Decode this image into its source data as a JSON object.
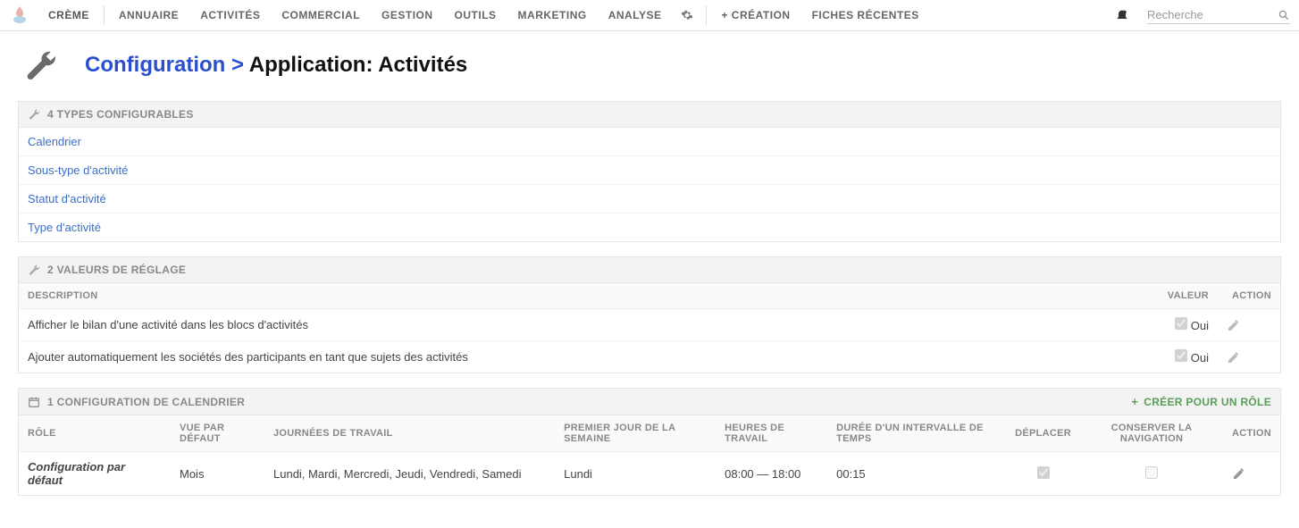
{
  "nav": {
    "brand": "CRÈME",
    "items": [
      "ANNUAIRE",
      "ACTIVITÉS",
      "COMMERCIAL",
      "GESTION",
      "OUTILS",
      "MARKETING",
      "ANALYSE"
    ],
    "creation": "+ CRÉATION",
    "recent": "FICHES RÉCENTES",
    "search_placeholder": "Recherche"
  },
  "breadcrumb": {
    "root": "Configuration",
    "sep": ">",
    "current": "Application: Activités"
  },
  "types_block": {
    "title": "4 TYPES CONFIGURABLES",
    "items": [
      "Calendrier",
      "Sous-type d'activité",
      "Statut d'activité",
      "Type d'activité"
    ]
  },
  "settings_block": {
    "title": "2 VALEURS DE RÉGLAGE",
    "columns": {
      "desc": "DESCRIPTION",
      "value": "VALEUR",
      "action": "ACTION"
    },
    "rows": [
      {
        "desc": "Afficher le bilan d'une activité dans les blocs d'activités",
        "value": "Oui",
        "checked": true
      },
      {
        "desc": "Ajouter automatiquement les sociétés des participants en tant que sujets des activités",
        "value": "Oui",
        "checked": true
      }
    ]
  },
  "calendar_block": {
    "title": "1 CONFIGURATION DE CALENDRIER",
    "create_label": "CRÉER POUR UN RÔLE",
    "columns": {
      "role": "RÔLE",
      "view": "VUE PAR DÉFAUT",
      "days": "JOURNÉES DE TRAVAIL",
      "first": "PREMIER JOUR DE LA SEMAINE",
      "hours": "HEURES DE TRAVAIL",
      "interval": "DURÉE D'UN INTERVALLE DE TEMPS",
      "drag": "DÉPLACER",
      "keepnav": "CONSERVER LA NAVIGATION",
      "action": "ACTION"
    },
    "rows": [
      {
        "role": "Configuration par défaut",
        "view": "Mois",
        "days": "Lundi, Mardi, Mercredi, Jeudi, Vendredi, Samedi",
        "first": "Lundi",
        "hours": "08:00 — 18:00",
        "interval": "00:15",
        "drag": true,
        "keepnav": false
      }
    ]
  }
}
